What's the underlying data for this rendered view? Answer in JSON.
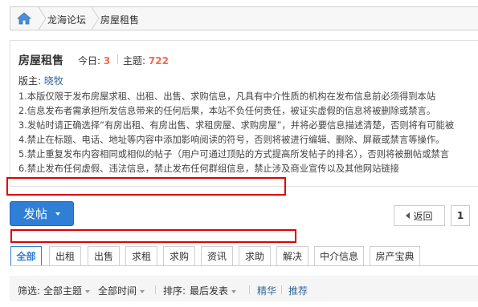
{
  "breadcrumb": {
    "items": [
      "龙海论坛",
      "房屋租售"
    ]
  },
  "forum": {
    "title": "房屋租售",
    "today_label": "今日:",
    "today_value": "3",
    "topics_label": "主题:",
    "topics_value": "722",
    "moderator_label": "版主:",
    "moderator_name": "晓牧"
  },
  "rules": [
    "1.本版仅限于发布房屋求租、出租、出售、求购信息，凡具有中介性质的机构在发布信息前必须得到本站",
    "2.信息发布者需承担所发信息带来的任何后果，本站不负任何责任，被证实虚假的信息将被删除或禁言。",
    "3.发帖时请正确选择“有房出租、有房出售、求租房屋、求购房屋”，并将必要信息描述清楚，否则将有可能被",
    "4.禁止在标题、电话、地址等内容中添加影响阅读的符号，否则将被进行编辑、删除、屏蔽或禁言等操作。",
    "5.禁止重复发布内容相同或相似的帖子（用户可通过顶贴的方式提高所发帖子的排名），否则将被删帖或禁言",
    "6.禁止发布任何虚假、违法信息，禁止发布任何群组信息，禁止涉及商业宣传以及其他网站链接"
  ],
  "actions": {
    "post_label": "发帖"
  },
  "pager": {
    "back_label": "返回",
    "current_page": "1"
  },
  "tabs": [
    "全部",
    "出租",
    "出售",
    "求租",
    "求购",
    "资讯",
    "求助",
    "解决",
    "中介信息",
    "房产宝典"
  ],
  "filters": {
    "label": "筛选:",
    "topic": "全部主题",
    "time": "全部时间",
    "sort_label": "排序:",
    "sort": "最后发表",
    "digest": "精华",
    "recommend": "推荐"
  },
  "colors": {
    "accent": "#2f7fd6",
    "count": "#f26c4f",
    "highlight_box": "#e00000"
  }
}
